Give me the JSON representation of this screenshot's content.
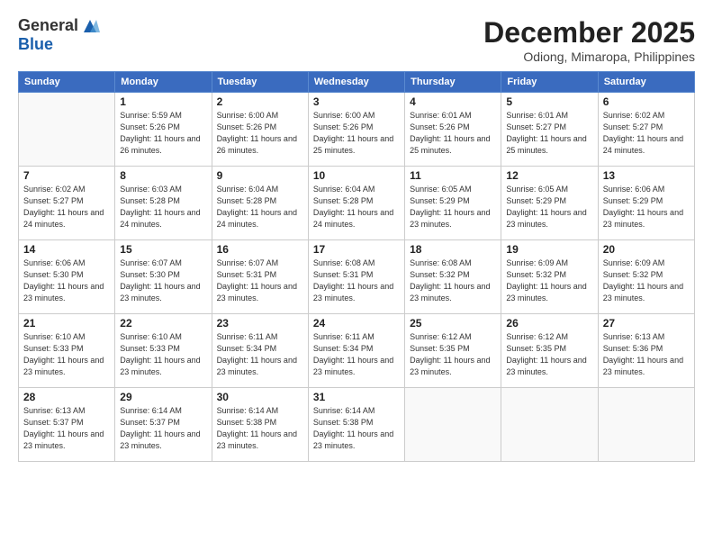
{
  "logo": {
    "general": "General",
    "blue": "Blue"
  },
  "title": "December 2025",
  "subtitle": "Odiong, Mimaropa, Philippines",
  "days_header": [
    "Sunday",
    "Monday",
    "Tuesday",
    "Wednesday",
    "Thursday",
    "Friday",
    "Saturday"
  ],
  "weeks": [
    [
      {
        "day": "",
        "sunrise": "",
        "sunset": "",
        "daylight": ""
      },
      {
        "day": "1",
        "sunrise": "Sunrise: 5:59 AM",
        "sunset": "Sunset: 5:26 PM",
        "daylight": "Daylight: 11 hours and 26 minutes."
      },
      {
        "day": "2",
        "sunrise": "Sunrise: 6:00 AM",
        "sunset": "Sunset: 5:26 PM",
        "daylight": "Daylight: 11 hours and 26 minutes."
      },
      {
        "day": "3",
        "sunrise": "Sunrise: 6:00 AM",
        "sunset": "Sunset: 5:26 PM",
        "daylight": "Daylight: 11 hours and 25 minutes."
      },
      {
        "day": "4",
        "sunrise": "Sunrise: 6:01 AM",
        "sunset": "Sunset: 5:26 PM",
        "daylight": "Daylight: 11 hours and 25 minutes."
      },
      {
        "day": "5",
        "sunrise": "Sunrise: 6:01 AM",
        "sunset": "Sunset: 5:27 PM",
        "daylight": "Daylight: 11 hours and 25 minutes."
      },
      {
        "day": "6",
        "sunrise": "Sunrise: 6:02 AM",
        "sunset": "Sunset: 5:27 PM",
        "daylight": "Daylight: 11 hours and 24 minutes."
      }
    ],
    [
      {
        "day": "7",
        "sunrise": "Sunrise: 6:02 AM",
        "sunset": "Sunset: 5:27 PM",
        "daylight": "Daylight: 11 hours and 24 minutes."
      },
      {
        "day": "8",
        "sunrise": "Sunrise: 6:03 AM",
        "sunset": "Sunset: 5:28 PM",
        "daylight": "Daylight: 11 hours and 24 minutes."
      },
      {
        "day": "9",
        "sunrise": "Sunrise: 6:04 AM",
        "sunset": "Sunset: 5:28 PM",
        "daylight": "Daylight: 11 hours and 24 minutes."
      },
      {
        "day": "10",
        "sunrise": "Sunrise: 6:04 AM",
        "sunset": "Sunset: 5:28 PM",
        "daylight": "Daylight: 11 hours and 24 minutes."
      },
      {
        "day": "11",
        "sunrise": "Sunrise: 6:05 AM",
        "sunset": "Sunset: 5:29 PM",
        "daylight": "Daylight: 11 hours and 23 minutes."
      },
      {
        "day": "12",
        "sunrise": "Sunrise: 6:05 AM",
        "sunset": "Sunset: 5:29 PM",
        "daylight": "Daylight: 11 hours and 23 minutes."
      },
      {
        "day": "13",
        "sunrise": "Sunrise: 6:06 AM",
        "sunset": "Sunset: 5:29 PM",
        "daylight": "Daylight: 11 hours and 23 minutes."
      }
    ],
    [
      {
        "day": "14",
        "sunrise": "Sunrise: 6:06 AM",
        "sunset": "Sunset: 5:30 PM",
        "daylight": "Daylight: 11 hours and 23 minutes."
      },
      {
        "day": "15",
        "sunrise": "Sunrise: 6:07 AM",
        "sunset": "Sunset: 5:30 PM",
        "daylight": "Daylight: 11 hours and 23 minutes."
      },
      {
        "day": "16",
        "sunrise": "Sunrise: 6:07 AM",
        "sunset": "Sunset: 5:31 PM",
        "daylight": "Daylight: 11 hours and 23 minutes."
      },
      {
        "day": "17",
        "sunrise": "Sunrise: 6:08 AM",
        "sunset": "Sunset: 5:31 PM",
        "daylight": "Daylight: 11 hours and 23 minutes."
      },
      {
        "day": "18",
        "sunrise": "Sunrise: 6:08 AM",
        "sunset": "Sunset: 5:32 PM",
        "daylight": "Daylight: 11 hours and 23 minutes."
      },
      {
        "day": "19",
        "sunrise": "Sunrise: 6:09 AM",
        "sunset": "Sunset: 5:32 PM",
        "daylight": "Daylight: 11 hours and 23 minutes."
      },
      {
        "day": "20",
        "sunrise": "Sunrise: 6:09 AM",
        "sunset": "Sunset: 5:32 PM",
        "daylight": "Daylight: 11 hours and 23 minutes."
      }
    ],
    [
      {
        "day": "21",
        "sunrise": "Sunrise: 6:10 AM",
        "sunset": "Sunset: 5:33 PM",
        "daylight": "Daylight: 11 hours and 23 minutes."
      },
      {
        "day": "22",
        "sunrise": "Sunrise: 6:10 AM",
        "sunset": "Sunset: 5:33 PM",
        "daylight": "Daylight: 11 hours and 23 minutes."
      },
      {
        "day": "23",
        "sunrise": "Sunrise: 6:11 AM",
        "sunset": "Sunset: 5:34 PM",
        "daylight": "Daylight: 11 hours and 23 minutes."
      },
      {
        "day": "24",
        "sunrise": "Sunrise: 6:11 AM",
        "sunset": "Sunset: 5:34 PM",
        "daylight": "Daylight: 11 hours and 23 minutes."
      },
      {
        "day": "25",
        "sunrise": "Sunrise: 6:12 AM",
        "sunset": "Sunset: 5:35 PM",
        "daylight": "Daylight: 11 hours and 23 minutes."
      },
      {
        "day": "26",
        "sunrise": "Sunrise: 6:12 AM",
        "sunset": "Sunset: 5:35 PM",
        "daylight": "Daylight: 11 hours and 23 minutes."
      },
      {
        "day": "27",
        "sunrise": "Sunrise: 6:13 AM",
        "sunset": "Sunset: 5:36 PM",
        "daylight": "Daylight: 11 hours and 23 minutes."
      }
    ],
    [
      {
        "day": "28",
        "sunrise": "Sunrise: 6:13 AM",
        "sunset": "Sunset: 5:37 PM",
        "daylight": "Daylight: 11 hours and 23 minutes."
      },
      {
        "day": "29",
        "sunrise": "Sunrise: 6:14 AM",
        "sunset": "Sunset: 5:37 PM",
        "daylight": "Daylight: 11 hours and 23 minutes."
      },
      {
        "day": "30",
        "sunrise": "Sunrise: 6:14 AM",
        "sunset": "Sunset: 5:38 PM",
        "daylight": "Daylight: 11 hours and 23 minutes."
      },
      {
        "day": "31",
        "sunrise": "Sunrise: 6:14 AM",
        "sunset": "Sunset: 5:38 PM",
        "daylight": "Daylight: 11 hours and 23 minutes."
      },
      {
        "day": "",
        "sunrise": "",
        "sunset": "",
        "daylight": ""
      },
      {
        "day": "",
        "sunrise": "",
        "sunset": "",
        "daylight": ""
      },
      {
        "day": "",
        "sunrise": "",
        "sunset": "",
        "daylight": ""
      }
    ]
  ]
}
